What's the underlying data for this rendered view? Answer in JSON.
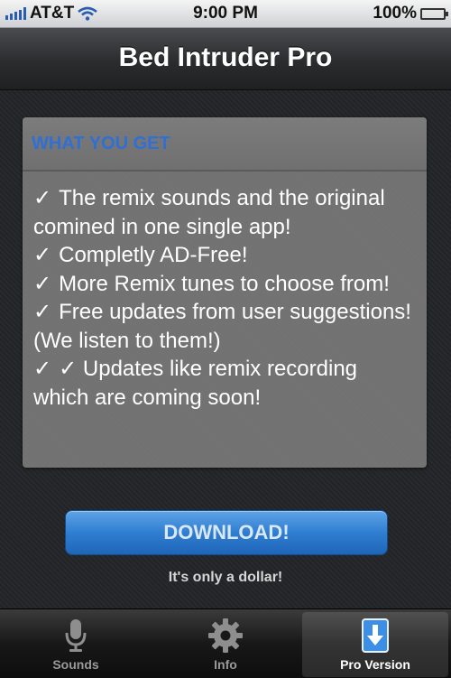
{
  "status_bar": {
    "carrier": "AT&T",
    "time": "9:00 PM",
    "battery_percent": "100%",
    "battery_level": 1.0,
    "icons": [
      "signal-bars-icon",
      "wifi-icon",
      "battery-icon"
    ]
  },
  "nav": {
    "title": "Bed Intruder Pro"
  },
  "panel": {
    "header": "WHAT YOU GET",
    "check_symbol": "✓",
    "features": [
      "The remix sounds and the original comined in one single app!",
      "Completly AD-Free!",
      "More Remix tunes to choose from!",
      "Free updates from user suggestions! (We listen to them!)",
      "✓ Updates like remix recording which are coming soon!"
    ]
  },
  "download": {
    "label": "DOWNLOAD!",
    "note": "It's only a dollar!"
  },
  "tabs": [
    {
      "label": "Sounds",
      "icon": "microphone-icon",
      "active": false
    },
    {
      "label": "Info",
      "icon": "gear-icon",
      "active": false
    },
    {
      "label": "Pro Version",
      "icon": "download-icon",
      "active": true
    }
  ],
  "colors": {
    "accent": "#2f6fd6",
    "button": "#2f7ed1",
    "battery": "#3fb13a"
  }
}
